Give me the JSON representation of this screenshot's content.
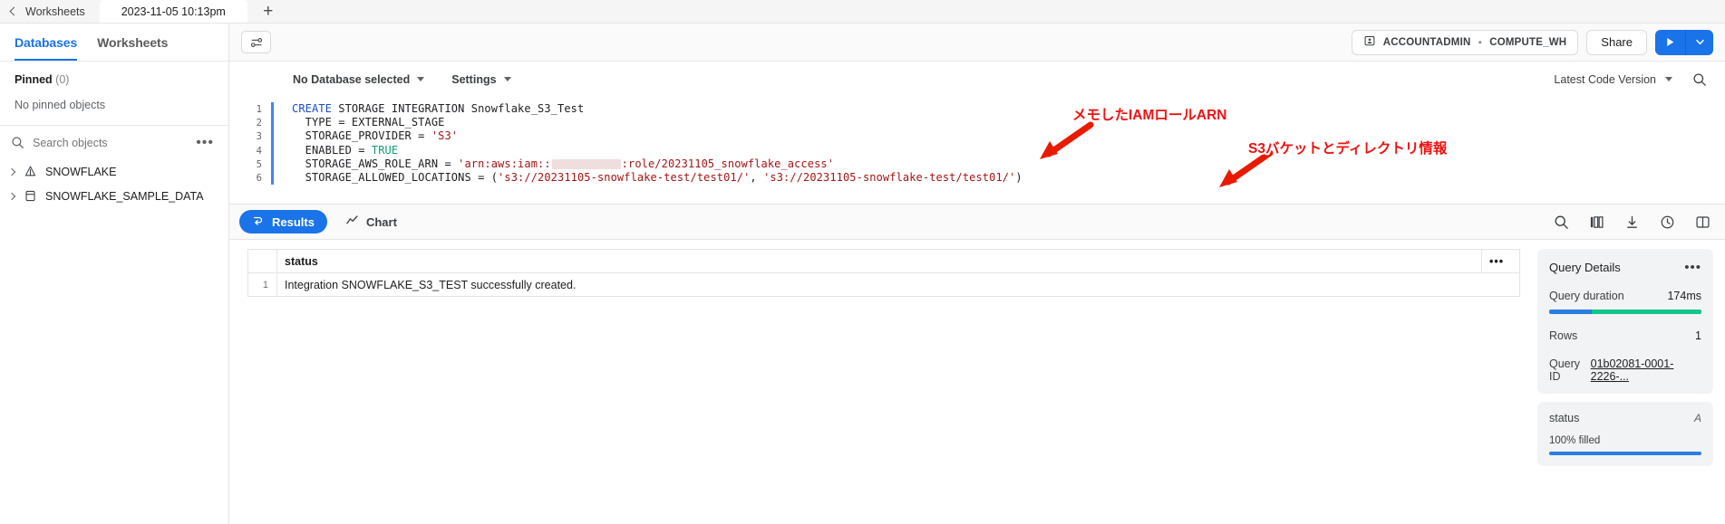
{
  "tabbar": {
    "back_label": "Worksheets",
    "active_tab": "2023-11-05 10:13pm",
    "new_tab_label": "+"
  },
  "sidebar": {
    "tabs": [
      {
        "label": "Databases",
        "active": true
      },
      {
        "label": "Worksheets",
        "active": false
      }
    ],
    "pinned_label": "Pinned",
    "pinned_count": "(0)",
    "no_pinned_text": "No pinned objects",
    "search_placeholder": "Search objects",
    "more_label": "•••",
    "objects": [
      {
        "label": "SNOWFLAKE",
        "icon": "snowflake-icon"
      },
      {
        "label": "SNOWFLAKE_SAMPLE_DATA",
        "icon": "database-icon"
      }
    ]
  },
  "toolbar": {
    "role": "ACCOUNTADMIN",
    "separator": "•",
    "warehouse": "COMPUTE_WH",
    "share_label": "Share",
    "run_label": "▶"
  },
  "editor_meta": {
    "database_label": "No Database selected",
    "settings_label": "Settings",
    "version_label": "Latest Code Version"
  },
  "code": {
    "lines": [
      {
        "n": "1",
        "segments": [
          {
            "t": "CREATE",
            "c": "k"
          },
          {
            "t": " STORAGE INTEGRATION Snowflake_S3_Test",
            "c": ""
          }
        ]
      },
      {
        "n": "2",
        "segments": [
          {
            "t": "  TYPE = EXTERNAL_STAGE",
            "c": ""
          }
        ]
      },
      {
        "n": "3",
        "segments": [
          {
            "t": "  STORAGE_PROVIDER = ",
            "c": ""
          },
          {
            "t": "'S3'",
            "c": "s"
          }
        ]
      },
      {
        "n": "4",
        "segments": [
          {
            "t": "  ENABLED = ",
            "c": ""
          },
          {
            "t": "TRUE",
            "c": "b"
          }
        ]
      },
      {
        "n": "5",
        "segments": [
          {
            "t": "  STORAGE_AWS_ROLE_ARN = ",
            "c": ""
          },
          {
            "t": "'arn:aws:iam::",
            "c": "s"
          },
          {
            "t": "",
            "c": "redact"
          },
          {
            "t": ":role/20231105_snowflake_access'",
            "c": "s"
          }
        ]
      },
      {
        "n": "6",
        "segments": [
          {
            "t": "  STORAGE_ALLOWED_LOCATIONS = (",
            "c": ""
          },
          {
            "t": "'s3://20231105-snowflake-test/test01/'",
            "c": "s"
          },
          {
            "t": ", ",
            "c": ""
          },
          {
            "t": "'s3://20231105-snowflake-test/test01/'",
            "c": "s"
          },
          {
            "t": ")",
            "c": ""
          }
        ]
      }
    ]
  },
  "annotations": [
    {
      "text": "メモしたIAMロールARN",
      "color": "#ee1111"
    },
    {
      "text": "S3バケットとディレクトリ情報",
      "color": "#ee1111"
    }
  ],
  "results": {
    "tabs": [
      {
        "label": "Results",
        "active": true,
        "icon": "results-icon"
      },
      {
        "label": "Chart",
        "active": false,
        "icon": "chart-icon"
      }
    ],
    "icons": [
      "search-icon",
      "columns-icon",
      "download-icon",
      "history-icon",
      "panel-icon"
    ],
    "table": {
      "columns": [
        "status"
      ],
      "row_index": "1",
      "rows": [
        {
          "index": "1",
          "status": "Integration SNOWFLAKE_S3_TEST successfully created."
        }
      ],
      "header_more": "•••"
    }
  },
  "query_details": {
    "title": "Query Details",
    "more": "•••",
    "duration_label": "Query duration",
    "duration_value": "174ms",
    "duration_bar": {
      "blue_pct": 28,
      "green_pct": 72,
      "blue": "#2a7de1",
      "green": "#12c58a"
    },
    "rows_label": "Rows",
    "rows_value": "1",
    "query_id_label": "Query ID",
    "query_id_value": "01b02081-0001-2226-...",
    "column_name": "status",
    "column_type": "A",
    "fill_label": "100% filled",
    "fill_pct": 100
  }
}
